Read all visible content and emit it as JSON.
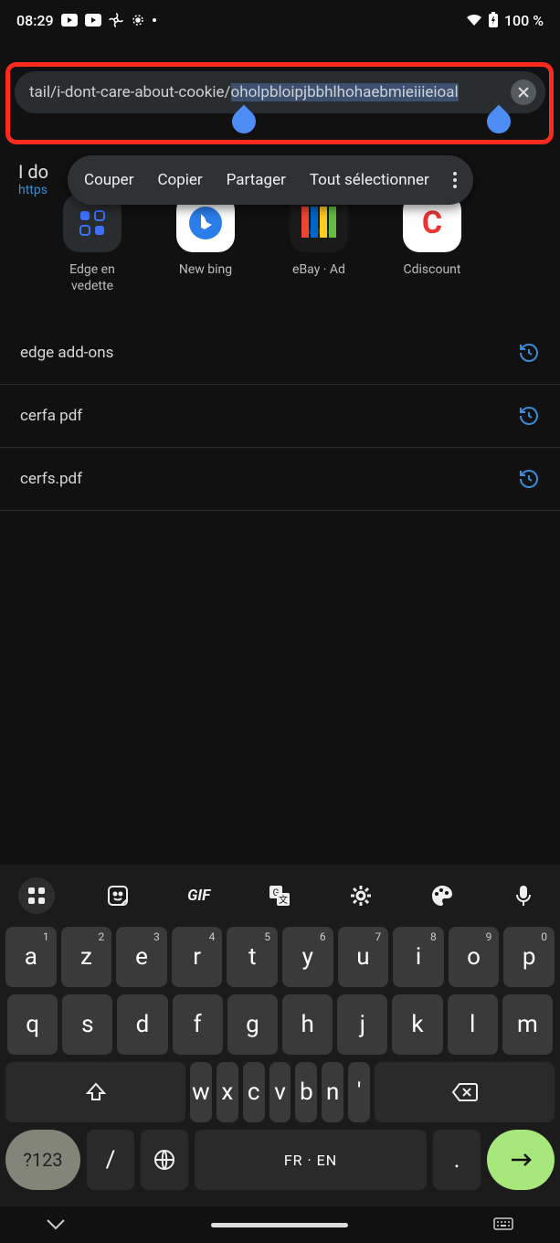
{
  "status": {
    "time": "08:29",
    "battery": "100 %"
  },
  "address": {
    "prefix": "tail/i-dont-care-about-cookie/",
    "selected": "oholpbloipjbbhlhohaebmieiiieioal"
  },
  "suggestion_peek": {
    "title": "I do",
    "url": "https"
  },
  "context_menu": {
    "cut": "Couper",
    "copy": "Copier",
    "share": "Partager",
    "select_all": "Tout sélectionner"
  },
  "tiles": [
    {
      "label": "Edge en vedette"
    },
    {
      "label": "New bing"
    },
    {
      "label": "eBay · Ad"
    },
    {
      "label": "Cdiscount"
    }
  ],
  "recent": [
    "edge add-ons",
    "cerfa pdf",
    "cerfs.pdf"
  ],
  "kb": {
    "gif": "GIF",
    "row1": [
      {
        "k": "a",
        "s": "1"
      },
      {
        "k": "z",
        "s": "2"
      },
      {
        "k": "e",
        "s": "3"
      },
      {
        "k": "r",
        "s": "4"
      },
      {
        "k": "t",
        "s": "5"
      },
      {
        "k": "y",
        "s": "6"
      },
      {
        "k": "u",
        "s": "7"
      },
      {
        "k": "i",
        "s": "8"
      },
      {
        "k": "o",
        "s": "9"
      },
      {
        "k": "p",
        "s": "0"
      }
    ],
    "row2": [
      "q",
      "s",
      "d",
      "f",
      "g",
      "h",
      "j",
      "k",
      "l",
      "m"
    ],
    "row3": [
      "w",
      "x",
      "c",
      "v",
      "b",
      "n"
    ],
    "sym": "?123",
    "slash": "/",
    "space": "FR · EN",
    "dot": ".",
    "apos": "'"
  }
}
